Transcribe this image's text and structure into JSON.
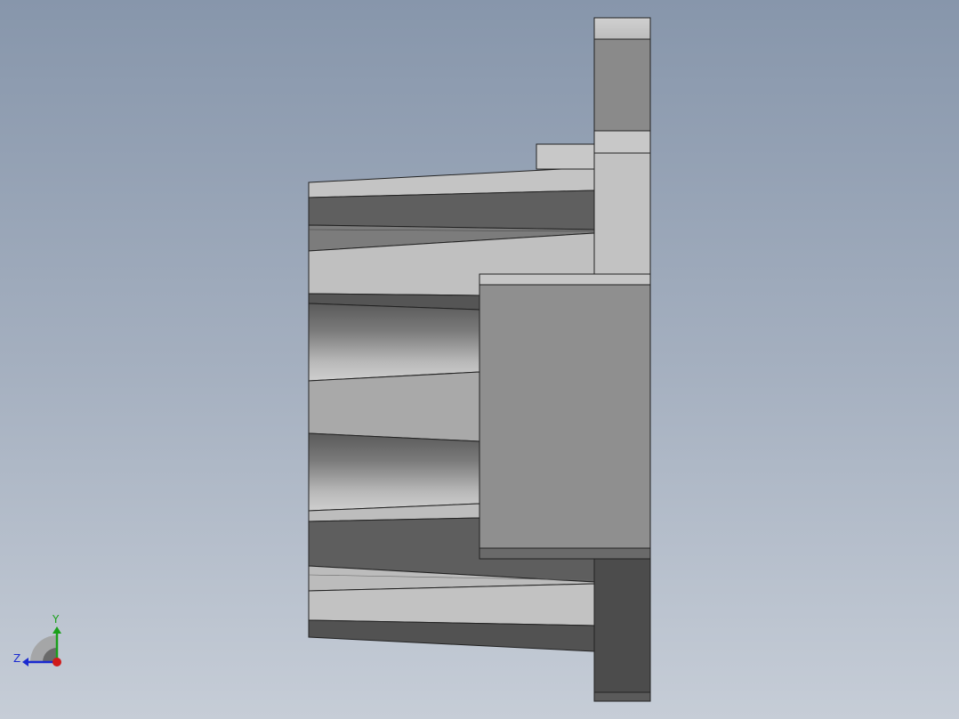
{
  "triad": {
    "y_label": "Y",
    "z_label": "Z",
    "colors": {
      "y_axis": "#1aa01a",
      "z_axis": "#1a2ad0",
      "x_axis": "#d01a1a"
    }
  },
  "model": {
    "shade_colors": {
      "light": "#c2c2c2",
      "mid": "#a8a8a8",
      "face": "#8e8e8e",
      "dark": "#5e5e5e",
      "darkest": "#4a4a4a"
    }
  }
}
